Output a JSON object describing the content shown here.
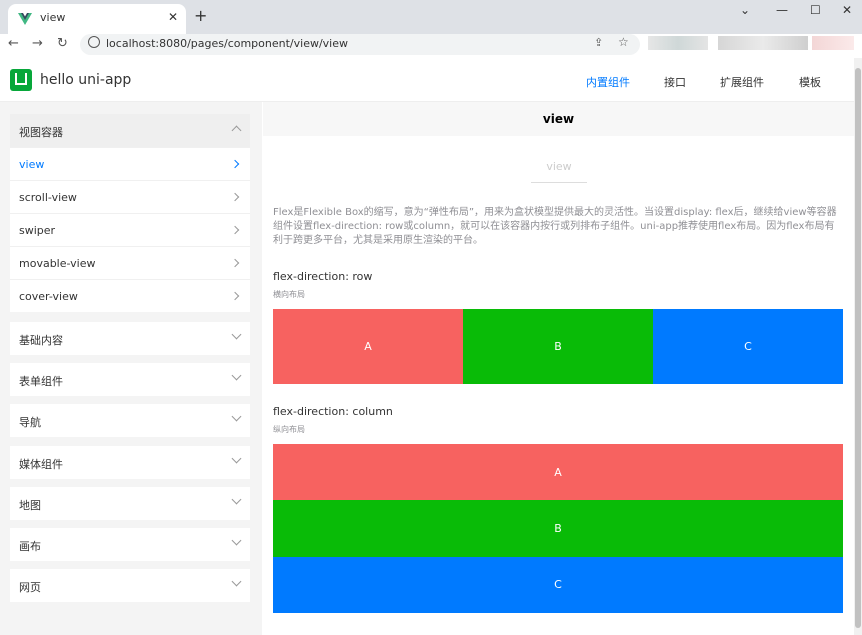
{
  "browser": {
    "tab_title": "view",
    "tab_close": "✕",
    "new_tab": "+",
    "controls": {
      "dropdown": "⌄",
      "minimize": "—",
      "maximize": "☐",
      "close": "✕"
    },
    "url": "localhost:8080/pages/component/view/view",
    "nav": {
      "back": "←",
      "forward": "→",
      "reload": "↻"
    },
    "url_share": "⇪",
    "url_star": "☆"
  },
  "app": {
    "title": "hello uni-app",
    "nav": [
      {
        "label": "内置组件",
        "active": true
      },
      {
        "label": "接口",
        "active": false
      },
      {
        "label": "扩展组件",
        "active": false
      },
      {
        "label": "模板",
        "active": false
      }
    ]
  },
  "sidebar": {
    "open_group": {
      "label": "视图容器",
      "items": [
        {
          "label": "view",
          "active": true
        },
        {
          "label": "scroll-view",
          "active": false
        },
        {
          "label": "swiper",
          "active": false
        },
        {
          "label": "movable-view",
          "active": false
        },
        {
          "label": "cover-view",
          "active": false
        }
      ]
    },
    "groups": [
      "基础内容",
      "表单组件",
      "导航",
      "媒体组件",
      "地图",
      "画布",
      "网页"
    ]
  },
  "page": {
    "head_title": "view",
    "section_title": "view",
    "intro": "Flex是Flexible Box的缩写，意为“弹性布局”，用来为盒状模型提供最大的灵活性。当设置display: flex后，继续给view等容器组件设置flex-direction: row或column，就可以在该容器内按行或列排布子组件。uni-app推荐使用flex布局。因为flex布局有利于跨更多平台，尤其是采用原生渲染的平台。",
    "row_title": "flex-direction: row",
    "row_sub": "横向布局",
    "col_title": "flex-direction: column",
    "col_sub": "纵向布局",
    "boxes": [
      {
        "label": "A",
        "color": "#f76260"
      },
      {
        "label": "B",
        "color": "#09bb07"
      },
      {
        "label": "C",
        "color": "#007aff"
      }
    ]
  }
}
